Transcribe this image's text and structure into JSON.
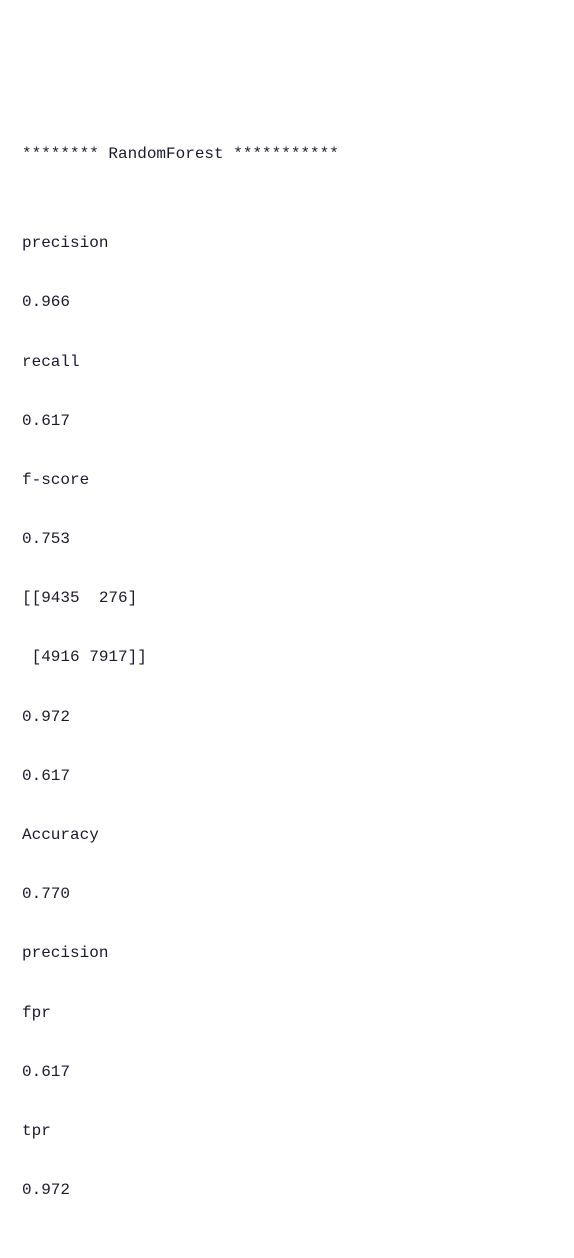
{
  "lines": {
    "l0": "******** RandomForest ***********",
    "l1": "",
    "l2": "precision",
    "l3": "0.966",
    "l4": "recall",
    "l5": "0.617",
    "l6": "f-score",
    "l7": "0.753",
    "l8": "[[9435  276]",
    "l9": " [4916 7917]]",
    "l10": "0.972",
    "l11": "0.617",
    "l12": "Accuracy",
    "l13": "0.770",
    "l14": "precision",
    "l15": "fpr",
    "l16": "0.617",
    "l17": "tpr",
    "l18": "0.972"
  }
}
